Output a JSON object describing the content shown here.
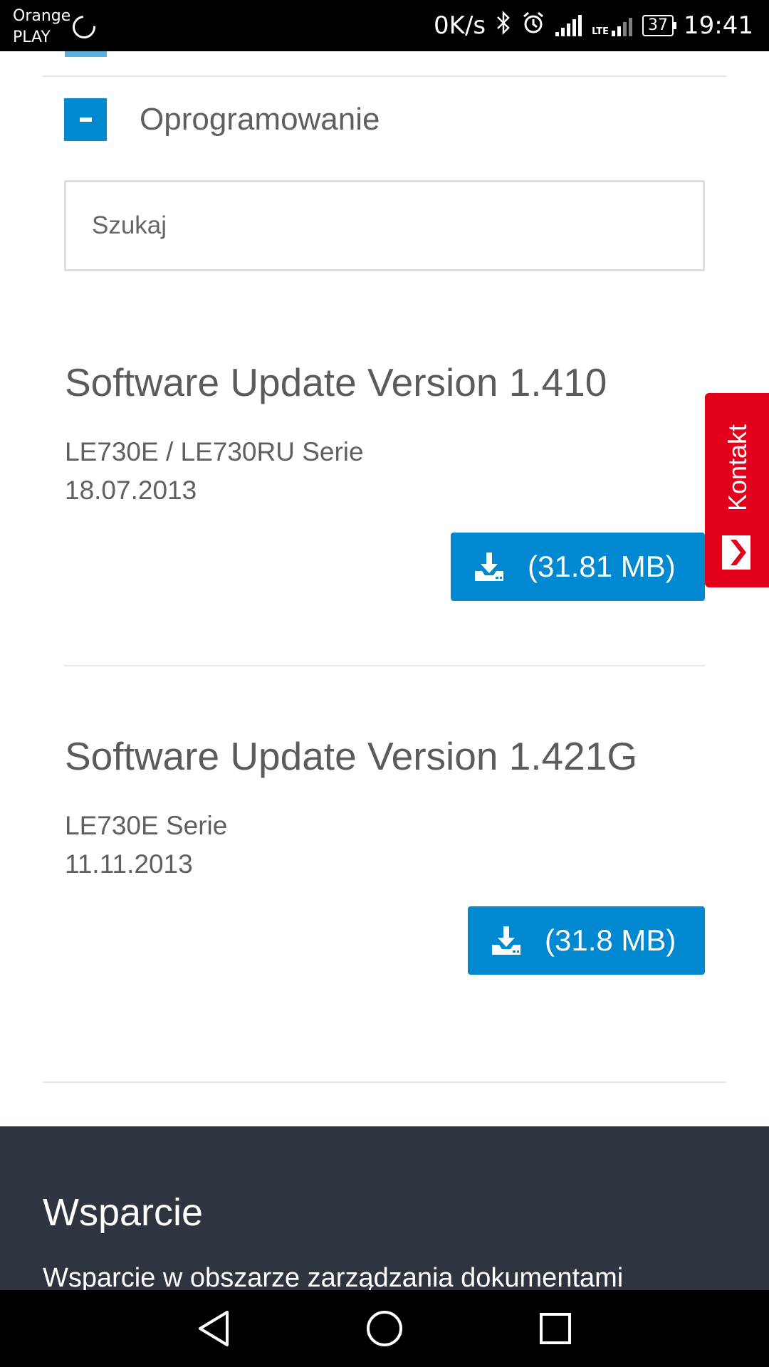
{
  "status_bar": {
    "carrier_1": "Orange",
    "carrier_2": "PLAY",
    "net_speed": "0K/s",
    "network_type": "LTE",
    "battery": "37",
    "time": "19:41",
    "icons": [
      "sync-icon",
      "bluetooth-icon",
      "alarm-icon",
      "signal-icon",
      "lte-signal-icon",
      "battery-icon"
    ]
  },
  "accordion": {
    "title": "Oprogramowanie",
    "toggle_icon": "minus-icon"
  },
  "search": {
    "placeholder": "Szukaj",
    "value": ""
  },
  "updates": [
    {
      "title": "Software Update Version 1.410",
      "series": "LE730E / LE730RU Serie",
      "date": "18.07.2013",
      "size": "(31.81 MB)",
      "icon": "download-icon"
    },
    {
      "title": "Software Update Version 1.421G",
      "series": "LE730E Serie",
      "date": "11.11.2013",
      "size": "(31.8 MB)",
      "icon": "download-icon"
    }
  ],
  "kontakt": {
    "label": "Kontakt",
    "icon": "chevron-right-icon"
  },
  "footer": {
    "title": "Wsparcie",
    "link": "Wsparcie w obszarze zarządzania dokumentami"
  },
  "nav_bar": {
    "buttons": [
      "back-icon",
      "home-icon",
      "recents-icon"
    ]
  },
  "colors": {
    "accent_blue": "#0088d1",
    "kontakt_red": "#e2001a",
    "footer_bg": "#2f3540"
  }
}
